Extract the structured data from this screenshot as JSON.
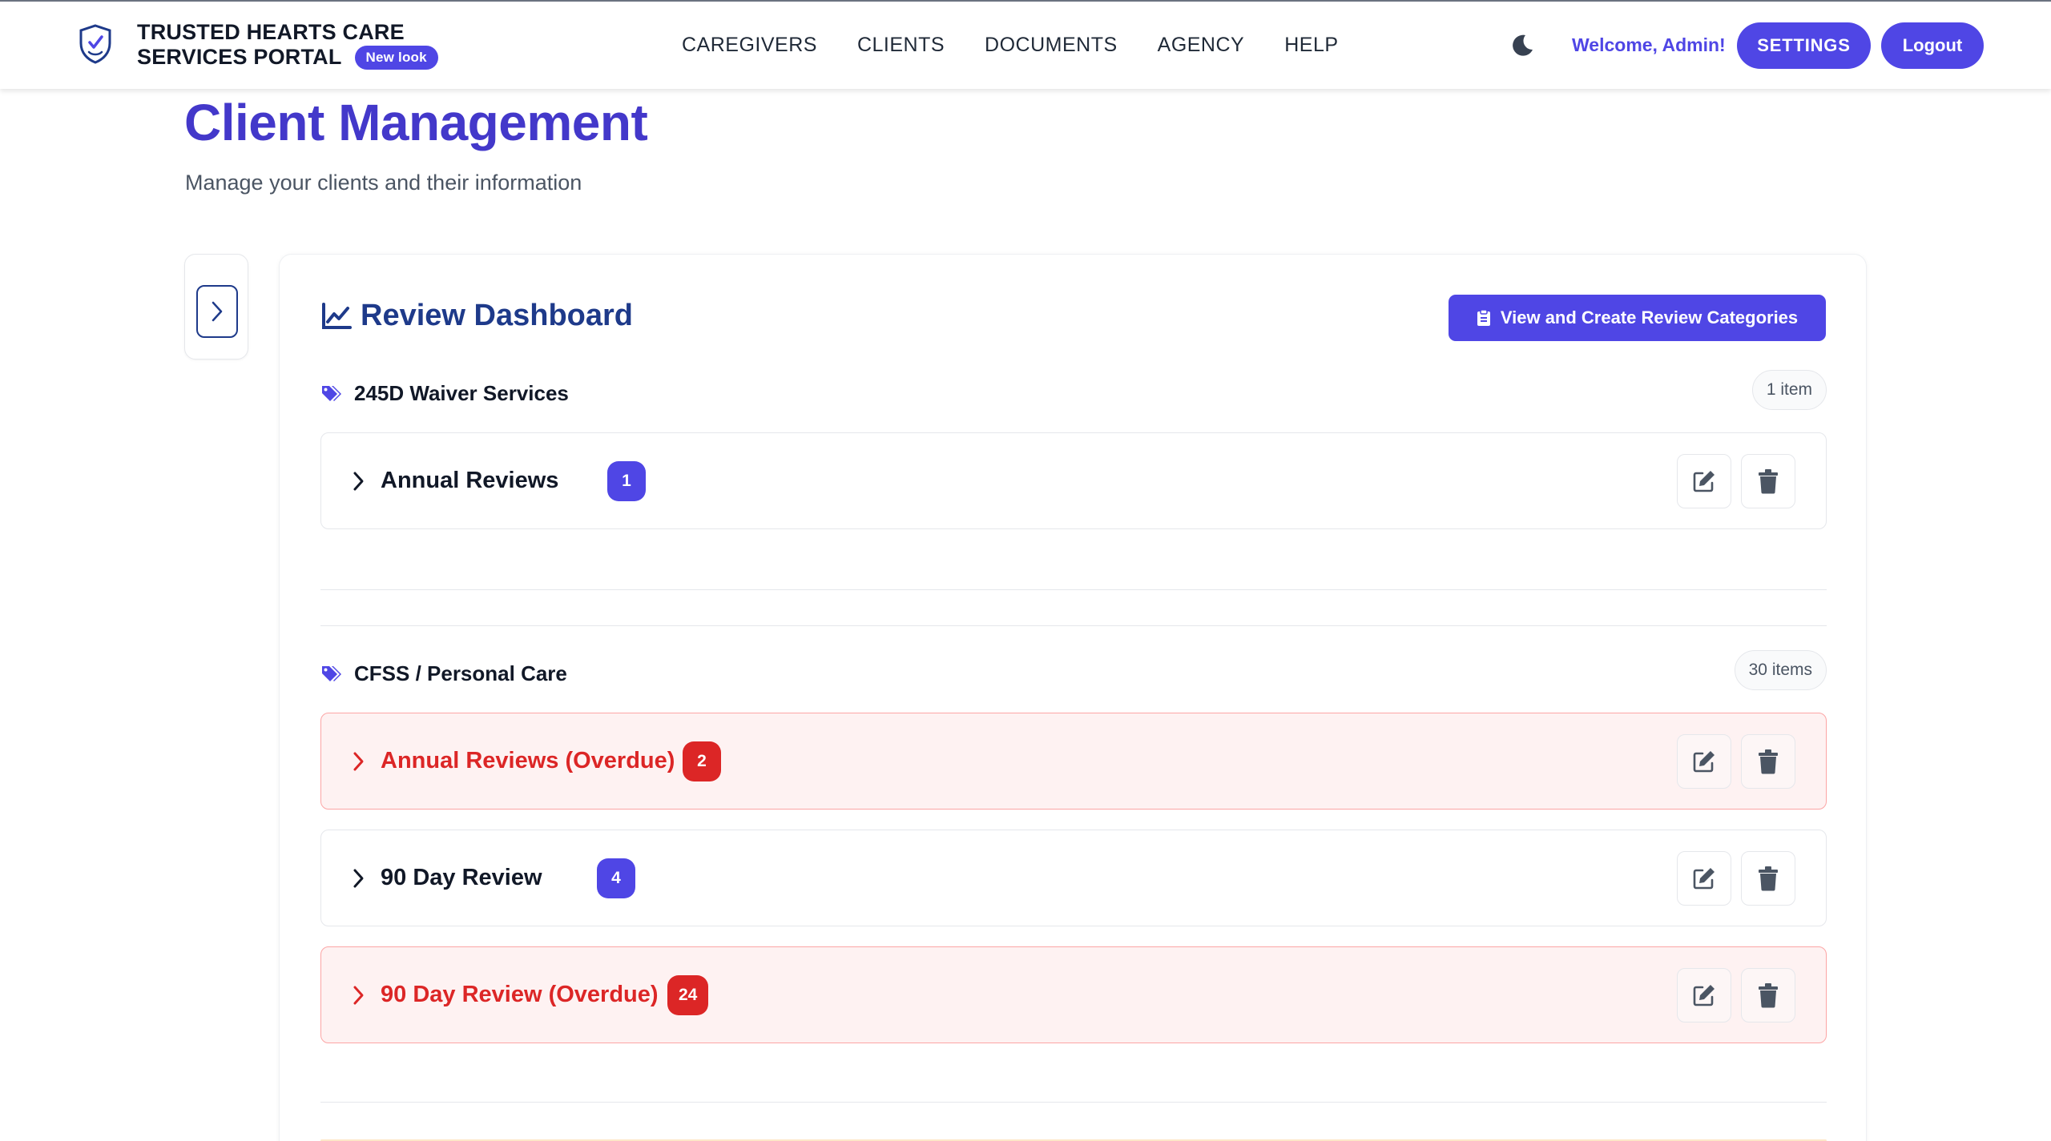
{
  "header": {
    "brand_line1": "TRUSTED HEARTS CARE",
    "brand_line2": "SERVICES PORTAL",
    "new_badge": "New look",
    "nav": [
      "CAREGIVERS",
      "CLIENTS",
      "DOCUMENTS",
      "AGENCY",
      "HELP"
    ],
    "theme_icon": "moon-icon",
    "welcome": "Welcome, Admin!",
    "settings_label": "SETTINGS",
    "logout_label": "Logout"
  },
  "page": {
    "title": "Client Management",
    "subtitle": "Manage your clients and their information"
  },
  "dashboard": {
    "title": "Review Dashboard",
    "title_icon": "chart-line-icon",
    "categories_button": "View and Create Review Categories",
    "groups": [
      {
        "name": "245D Waiver Services",
        "count_label": "1 item",
        "items": [
          {
            "label": "Annual Reviews",
            "count": "1",
            "overdue": false
          }
        ]
      },
      {
        "name": "CFSS / Personal Care",
        "count_label": "30 items",
        "items": [
          {
            "label": "Annual Reviews (Overdue)",
            "count": "2",
            "overdue": true
          },
          {
            "label": "90 Day Review",
            "count": "4",
            "overdue": false
          },
          {
            "label": "90 Day Review (Overdue)",
            "count": "24",
            "overdue": true
          }
        ]
      }
    ]
  },
  "colors": {
    "primary": "#4f46e5",
    "title": "#4338ca",
    "heading": "#1e3a8a",
    "overdue": "#dc2626",
    "overdue_bg": "#fef2f2"
  }
}
